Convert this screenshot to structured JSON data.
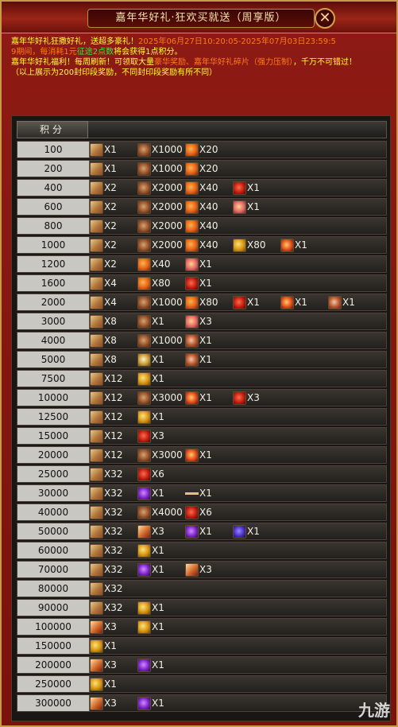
{
  "window": {
    "title": "嘉年华好礼·狂欢买就送（周享版）",
    "close_label": "✕"
  },
  "info": {
    "line1_a": "嘉年华好礼狂撒好礼，送超多豪礼！",
    "line1_b": "2025年06月27日10:20:05-2025年07月03日23:59:5",
    "line2_a": "9期间，每消耗1元",
    "line2_b": "征途2点数",
    "line2_c": "将会获得1点积分。",
    "line3_a": "嘉年华好礼福利！每周刷新！可领取大量",
    "line3_b": "豪华奖励、嘉年华好礼碎片（强力压制）",
    "line3_c": "，千万不可错过！",
    "line4": "（以上展示为200封印段奖励，不同封印段奖励有所不同）"
  },
  "table": {
    "header_score": "积分",
    "rows": [
      {
        "score": "100",
        "rewards": [
          {
            "icon": "scroll-icon",
            "qty": "X1"
          },
          {
            "icon": "meat-icon",
            "qty": "X1000"
          },
          {
            "icon": "feather-icon",
            "qty": "X20"
          }
        ]
      },
      {
        "score": "200",
        "rewards": [
          {
            "icon": "scroll-icon",
            "qty": "X1"
          },
          {
            "icon": "meat-icon",
            "qty": "X1000"
          },
          {
            "icon": "feather-icon",
            "qty": "X20"
          }
        ]
      },
      {
        "score": "400",
        "rewards": [
          {
            "icon": "scroll-icon",
            "qty": "X2"
          },
          {
            "icon": "meat-icon",
            "qty": "X2000"
          },
          {
            "icon": "feather-icon",
            "qty": "X40"
          },
          {
            "icon": "red-gift-icon",
            "qty": "X1"
          }
        ]
      },
      {
        "score": "600",
        "rewards": [
          {
            "icon": "scroll-icon",
            "qty": "X2"
          },
          {
            "icon": "meat-icon",
            "qty": "X2000"
          },
          {
            "icon": "feather-icon",
            "qty": "X40"
          },
          {
            "icon": "pink-gift-icon",
            "qty": "X1"
          }
        ]
      },
      {
        "score": "800",
        "rewards": [
          {
            "icon": "scroll-icon",
            "qty": "X2"
          },
          {
            "icon": "meat-icon",
            "qty": "X2000"
          },
          {
            "icon": "feather-icon",
            "qty": "X40"
          }
        ]
      },
      {
        "score": "1000",
        "rewards": [
          {
            "icon": "scroll-icon",
            "qty": "X2"
          },
          {
            "icon": "meat-icon",
            "qty": "X2000"
          },
          {
            "icon": "feather-icon",
            "qty": "X40"
          },
          {
            "icon": "gold-orb-icon",
            "qty": "X80"
          },
          {
            "icon": "fire-orb-icon",
            "qty": "X1"
          }
        ]
      },
      {
        "score": "1200",
        "rewards": [
          {
            "icon": "scroll-icon",
            "qty": "X2"
          },
          {
            "icon": "feather-icon",
            "qty": "X40"
          },
          {
            "icon": "pink-gift-icon",
            "qty": "X1"
          }
        ]
      },
      {
        "score": "1600",
        "rewards": [
          {
            "icon": "scroll-icon",
            "qty": "X4"
          },
          {
            "icon": "feather-icon",
            "qty": "X80"
          },
          {
            "icon": "red-gift-icon",
            "qty": "X1"
          }
        ]
      },
      {
        "score": "2000",
        "rewards": [
          {
            "icon": "scroll-icon",
            "qty": "X4"
          },
          {
            "icon": "meat-icon",
            "qty": "X1000"
          },
          {
            "icon": "feather-icon",
            "qty": "X80"
          },
          {
            "icon": "red-gift-icon",
            "qty": "X1"
          },
          {
            "icon": "fire-orb-icon",
            "qty": "X1"
          },
          {
            "icon": "cake-icon",
            "qty": "X1"
          }
        ]
      },
      {
        "score": "3000",
        "rewards": [
          {
            "icon": "scroll-icon",
            "qty": "X8"
          },
          {
            "icon": "meat-icon",
            "qty": "X1"
          },
          {
            "icon": "pink-gift-icon",
            "qty": "X3"
          }
        ]
      },
      {
        "score": "4000",
        "rewards": [
          {
            "icon": "scroll-icon",
            "qty": "X8"
          },
          {
            "icon": "meat-icon",
            "qty": "X1000"
          },
          {
            "icon": "cake-icon",
            "qty": "X1"
          }
        ]
      },
      {
        "score": "5000",
        "rewards": [
          {
            "icon": "scroll-icon",
            "qty": "X8"
          },
          {
            "icon": "coin-icon",
            "qty": "X1"
          },
          {
            "icon": "cake-icon",
            "qty": "X1"
          }
        ]
      },
      {
        "score": "7500",
        "rewards": [
          {
            "icon": "scroll-icon",
            "qty": "X12"
          },
          {
            "icon": "gold-orb-icon",
            "qty": "X1"
          }
        ]
      },
      {
        "score": "10000",
        "rewards": [
          {
            "icon": "scroll-icon",
            "qty": "X12"
          },
          {
            "icon": "meat-icon",
            "qty": "X3000"
          },
          {
            "icon": "fire-orb-icon",
            "qty": "X1"
          },
          {
            "icon": "red-gift-icon",
            "qty": "X3"
          }
        ]
      },
      {
        "score": "12500",
        "rewards": [
          {
            "icon": "scroll-icon",
            "qty": "X12"
          },
          {
            "icon": "gold-orb-icon",
            "qty": "X1"
          }
        ]
      },
      {
        "score": "15000",
        "rewards": [
          {
            "icon": "scroll-icon",
            "qty": "X12"
          },
          {
            "icon": "red-gift-icon",
            "qty": "X3"
          }
        ]
      },
      {
        "score": "20000",
        "rewards": [
          {
            "icon": "scroll-icon",
            "qty": "X12"
          },
          {
            "icon": "meat-icon",
            "qty": "X3000"
          },
          {
            "icon": "fire-orb-icon",
            "qty": "X1"
          }
        ]
      },
      {
        "score": "25000",
        "rewards": [
          {
            "icon": "scroll-icon",
            "qty": "X32"
          },
          {
            "icon": "red-gift-icon",
            "qty": "X6"
          }
        ]
      },
      {
        "score": "30000",
        "rewards": [
          {
            "icon": "scroll-icon",
            "qty": "X32"
          },
          {
            "icon": "purple-gem-icon",
            "qty": "X1"
          },
          {
            "icon": "stick-icon",
            "qty": "X1"
          }
        ]
      },
      {
        "score": "40000",
        "rewards": [
          {
            "icon": "scroll-icon",
            "qty": "X32"
          },
          {
            "icon": "meat-icon",
            "qty": "X4000"
          },
          {
            "icon": "red-gift-icon",
            "qty": "X6"
          }
        ]
      },
      {
        "score": "50000",
        "rewards": [
          {
            "icon": "scroll-icon",
            "qty": "X32"
          },
          {
            "icon": "red-scroll-icon",
            "qty": "X3"
          },
          {
            "icon": "purple-gem-icon",
            "qty": "X1"
          },
          {
            "icon": "purple-crystal-icon",
            "qty": "X1"
          }
        ]
      },
      {
        "score": "60000",
        "rewards": [
          {
            "icon": "scroll-icon",
            "qty": "X32"
          },
          {
            "icon": "gold-orb-icon",
            "qty": "X1"
          }
        ]
      },
      {
        "score": "70000",
        "rewards": [
          {
            "icon": "scroll-icon",
            "qty": "X32"
          },
          {
            "icon": "purple-gem-icon",
            "qty": "X1"
          },
          {
            "icon": "red-scroll-icon",
            "qty": "X3"
          }
        ]
      },
      {
        "score": "80000",
        "rewards": [
          {
            "icon": "scroll-icon",
            "qty": "X32"
          }
        ]
      },
      {
        "score": "90000",
        "rewards": [
          {
            "icon": "scroll-icon",
            "qty": "X32"
          },
          {
            "icon": "gold-orb-icon",
            "qty": "X1"
          }
        ]
      },
      {
        "score": "100000",
        "rewards": [
          {
            "icon": "red-scroll-icon",
            "qty": "X3"
          },
          {
            "icon": "gold-orb-icon",
            "qty": "X1"
          }
        ]
      },
      {
        "score": "150000",
        "rewards": [
          {
            "icon": "gold-orb-icon",
            "qty": "X1"
          }
        ]
      },
      {
        "score": "200000",
        "rewards": [
          {
            "icon": "red-scroll-icon",
            "qty": "X3"
          },
          {
            "icon": "purple-gem-icon",
            "qty": "X1"
          }
        ]
      },
      {
        "score": "250000",
        "rewards": [
          {
            "icon": "gold-orb-icon",
            "qty": "X1"
          }
        ]
      },
      {
        "score": "300000",
        "rewards": [
          {
            "icon": "red-scroll-icon",
            "qty": "X3"
          },
          {
            "icon": "purple-gem-icon",
            "qty": "X1"
          }
        ]
      }
    ]
  },
  "watermark": "九游"
}
